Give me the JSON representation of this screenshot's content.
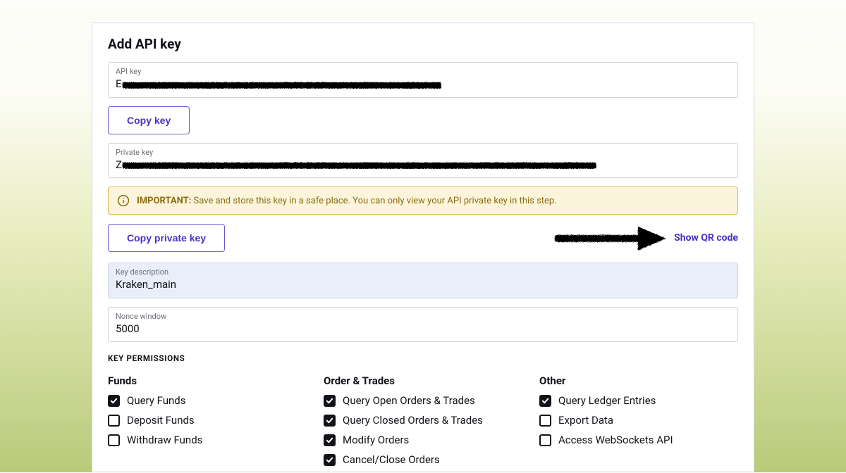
{
  "title": "Add API key",
  "api_key": {
    "label": "API key",
    "prefix": "E"
  },
  "copy_key_label": "Copy key",
  "private_key": {
    "label": "Private key",
    "prefix": "Z"
  },
  "notice": {
    "important": "IMPORTANT:",
    "text": "Save and store this key in a safe place. You can only view your API private key in this step."
  },
  "copy_private_key_label": "Copy private key",
  "show_qr_label": "Show QR code",
  "key_description": {
    "label": "Key description",
    "value": "Kraken_main"
  },
  "nonce_window": {
    "label": "Nonce window",
    "value": "5000"
  },
  "key_permissions_label": "KEY PERMISSIONS",
  "permissions": {
    "funds": {
      "title": "Funds",
      "items": [
        {
          "label": "Query Funds",
          "checked": true
        },
        {
          "label": "Deposit Funds",
          "checked": false
        },
        {
          "label": "Withdraw Funds",
          "checked": false
        }
      ]
    },
    "orders": {
      "title": "Order & Trades",
      "items": [
        {
          "label": "Query Open Orders & Trades",
          "checked": true
        },
        {
          "label": "Query Closed Orders & Trades",
          "checked": true
        },
        {
          "label": "Modify Orders",
          "checked": true
        },
        {
          "label": "Cancel/Close Orders",
          "checked": true
        }
      ]
    },
    "other": {
      "title": "Other",
      "items": [
        {
          "label": "Query Ledger Entries",
          "checked": true
        },
        {
          "label": "Export Data",
          "checked": false
        },
        {
          "label": "Access WebSockets API",
          "checked": false
        }
      ]
    }
  }
}
